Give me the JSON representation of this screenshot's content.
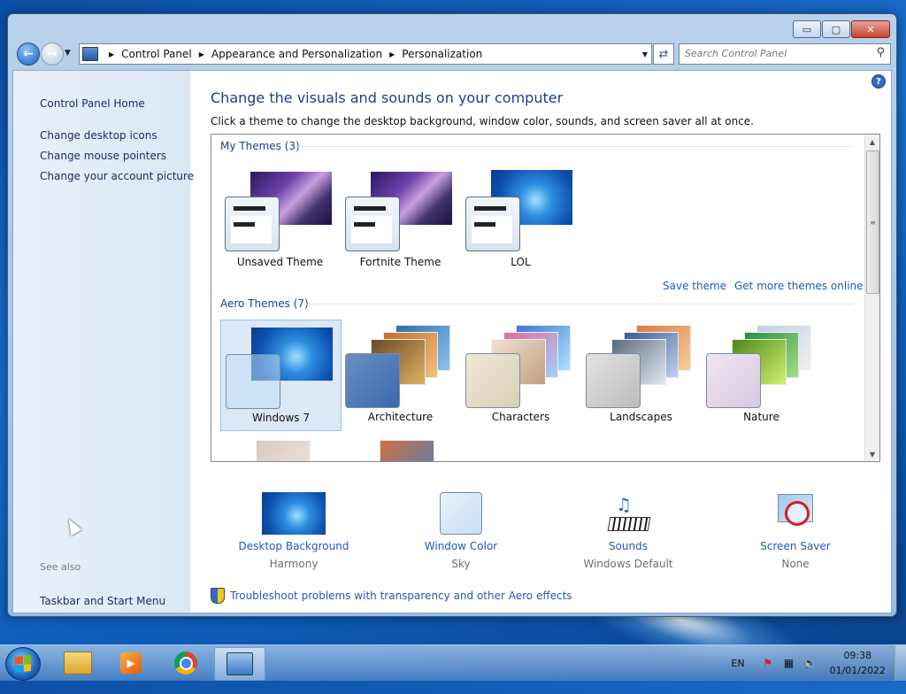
{
  "window": {
    "controls": {
      "minimize": "▭",
      "maximize": "▢",
      "close": "✕"
    }
  },
  "nav": {
    "breadcrumb": [
      "Control Panel",
      "Appearance and Personalization",
      "Personalization"
    ],
    "search_placeholder": "Search Control Panel"
  },
  "sidebar": {
    "home": "Control Panel Home",
    "links": [
      "Change desktop icons",
      "Change mouse pointers",
      "Change your account picture"
    ],
    "see_also_label": "See also",
    "see_also_links": [
      "Taskbar and Start Menu"
    ]
  },
  "main": {
    "title": "Change the visuals and sounds on your computer",
    "subtitle": "Click a theme to change the desktop background, window color, sounds, and screen saver all at once.",
    "my_themes_header": "My Themes (3)",
    "my_themes": [
      "Unsaved Theme",
      "Fortnite Theme",
      "LOL"
    ],
    "save_theme": "Save theme",
    "get_more": "Get more themes online",
    "aero_header": "Aero Themes (7)",
    "aero_themes": [
      "Windows 7",
      "Architecture",
      "Characters",
      "Landscapes",
      "Nature"
    ],
    "selected_theme": "Windows 7",
    "troubleshoot": "Troubleshoot problems with transparency and other Aero effects"
  },
  "settings": [
    {
      "name": "Desktop Background",
      "value": "Harmony",
      "icon": "desktop-background-icon"
    },
    {
      "name": "Window Color",
      "value": "Sky",
      "icon": "window-color-icon"
    },
    {
      "name": "Sounds",
      "value": "Windows Default",
      "icon": "sounds-icon"
    },
    {
      "name": "Screen Saver",
      "value": "None",
      "icon": "screen-saver-icon"
    }
  ],
  "taskbar": {
    "apps": [
      "explorer-icon",
      "media-player-icon",
      "chrome-icon",
      "control-panel-icon"
    ],
    "language": "EN",
    "time": "09:38",
    "date": "01/01/2022"
  },
  "colors": {
    "accent_link": "#1f5cb0",
    "heading": "#1e3d8c",
    "selection": "#dbe8f8"
  }
}
